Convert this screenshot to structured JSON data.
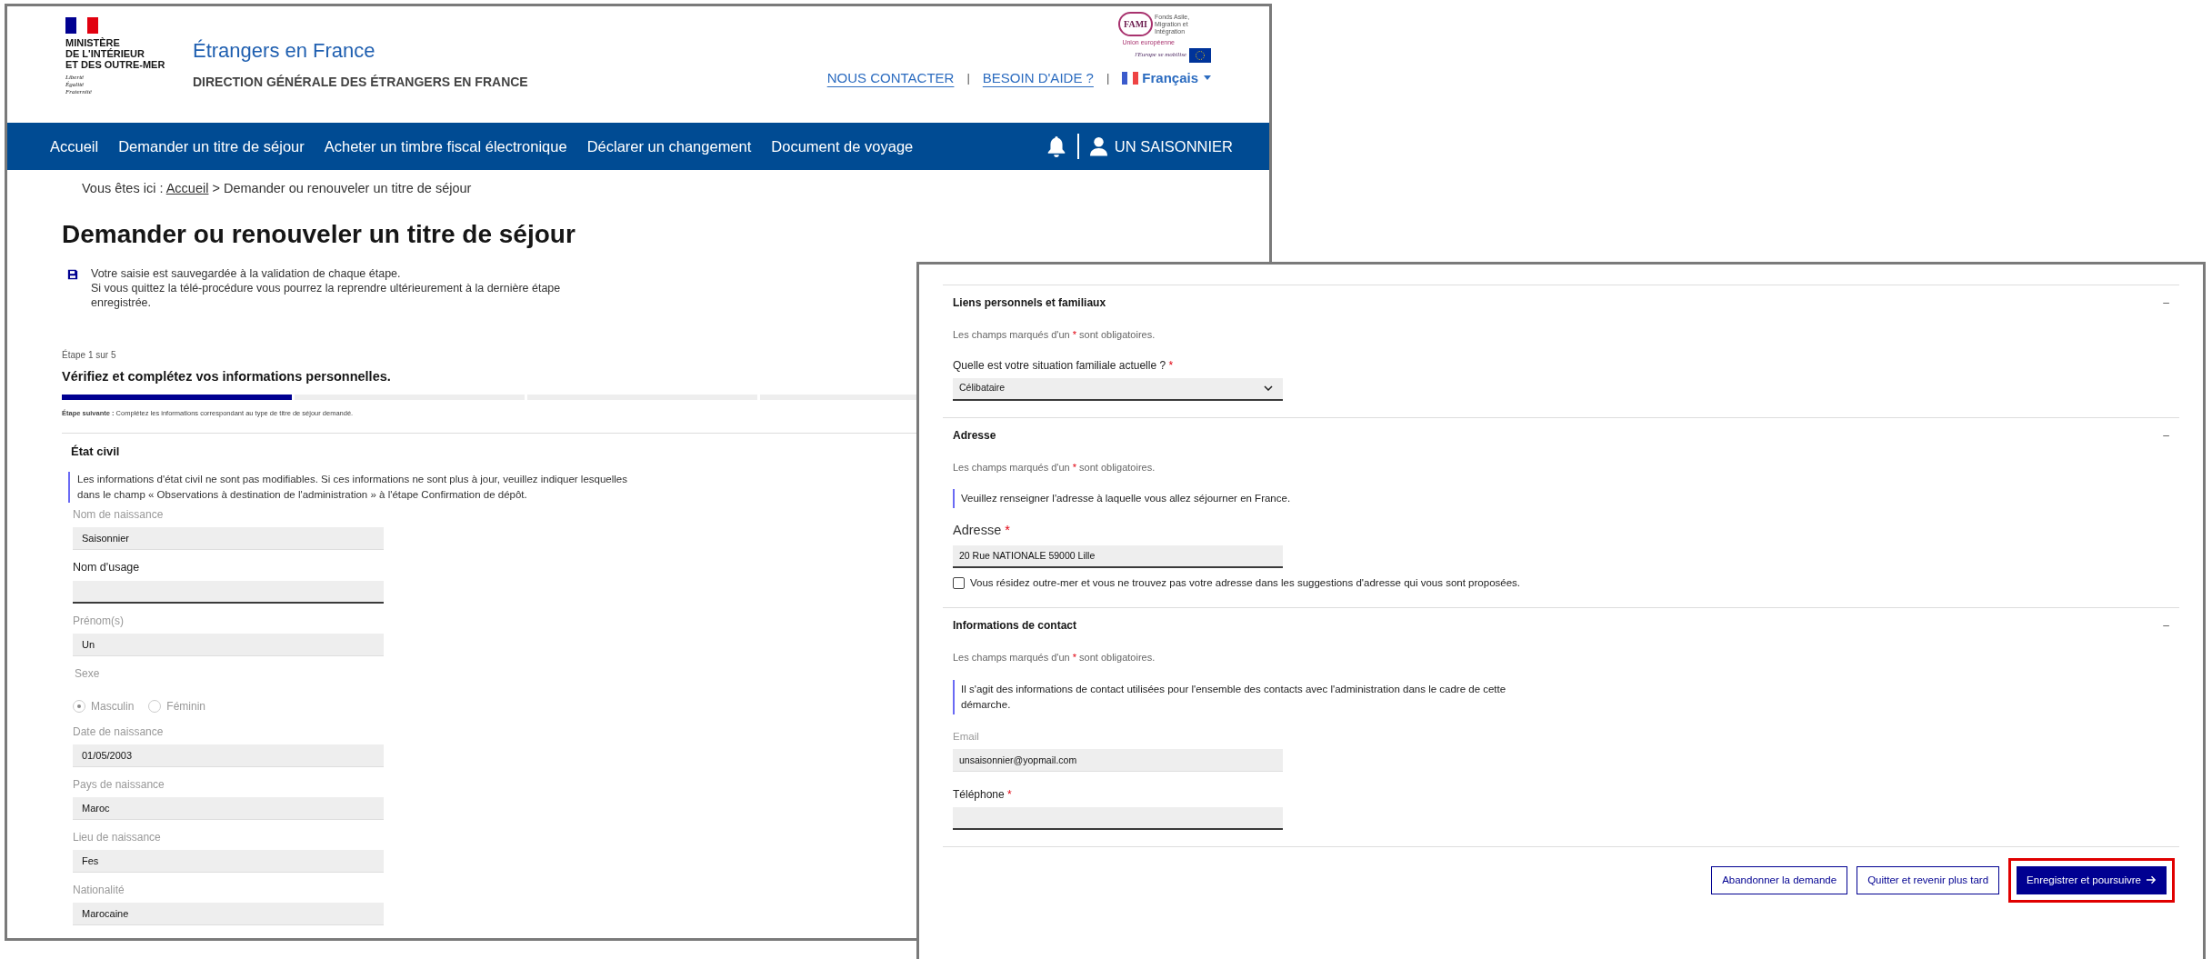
{
  "left_page": {
    "header": {
      "ministry": {
        "lines": [
          "MINISTÈRE",
          "DE L'INTÉRIEUR",
          "ET DES OUTRE-MER"
        ],
        "motto": [
          "Liberté",
          "Égalité",
          "Fraternité"
        ]
      },
      "site_title": "Étrangers en France",
      "site_subtitle": "DIRECTION GÉNÉRALE DES ÉTRANGERS EN FRANCE",
      "partner_logo": {
        "acronym": "FAMI",
        "caption": "Fonds Asile, Migration et Intégration",
        "union": "Union européenne",
        "slogan": "l'Europe se mobilise"
      },
      "links": [
        "NOUS CONTACTER",
        "BESOIN D'AIDE ?"
      ],
      "separator": "|",
      "language": "Français"
    },
    "nav": {
      "items": [
        "Accueil",
        "Demander un titre de séjour",
        "Acheter un timbre fiscal électronique",
        "Déclarer un changement",
        "Document de voyage"
      ],
      "user": "UN SAISONNIER"
    },
    "breadcrumb": {
      "prefix": "Vous êtes ici :",
      "link": "Accueil",
      "current": "> Demander ou renouveler un titre de séjour"
    },
    "title": "Demander ou renouveler un titre de séjour",
    "save_notice": [
      "Votre saisie est sauvegardée à la validation de chaque étape.",
      "Si vous quittez la télé-procédure vous pourrez la reprendre ultérieurement à la dernière étape enregistrée."
    ],
    "step": {
      "counter": "Étape 1 sur 5",
      "title": "Vérifiez et complétez vos informations personnelles.",
      "segments": [
        {
          "filled": true
        },
        {
          "filled": false
        },
        {
          "filled": false
        },
        {
          "filled": false
        }
      ],
      "next": "**Étape suivante :** Complétez les informations correspondant au type de titre de séjour demandé."
    },
    "section": {
      "title": "État civil",
      "info": "Les informations d'état civil ne sont pas modifiables. Si ces informations ne sont plus à jour, veuillez indiquer lesquelles dans le champ « Observations à destination de l'administration » à l'étape Confirmation de dépôt.",
      "fields": [
        {
          "kind": "text",
          "label": "Nom de naissance",
          "value": "Saisonnier",
          "disabled": true
        },
        {
          "kind": "text",
          "label": "Nom d'usage",
          "disabled": false
        },
        {
          "kind": "text",
          "label": "Prénom(s)",
          "value": "Un",
          "disabled": true
        },
        {
          "kind": "radio",
          "label": "Sexe",
          "disabled": true,
          "options": [
            {
              "label": "Masculin",
              "selected": true
            },
            {
              "label": "Féminin",
              "selected": false
            }
          ]
        },
        {
          "kind": "text",
          "label": "Date de naissance",
          "value": "01/05/2003",
          "disabled": true
        },
        {
          "kind": "text",
          "label": "Pays de naissance",
          "value": "Maroc",
          "disabled": true
        },
        {
          "kind": "text",
          "label": "Lieu de naissance",
          "value": "Fes",
          "disabled": true
        },
        {
          "kind": "text",
          "label": "Nationalité",
          "value": "Marocaine",
          "disabled": true
        }
      ]
    }
  },
  "right_page": {
    "sections": [
      {
        "title": "Liens personnels et familiaux",
        "toggle": "–",
        "required_note": {
          "before": "Les champs marqués d'un",
          "star": "*",
          "after": "sont obligatoires."
        },
        "fields": [
          {
            "kind": "select",
            "label": "Quelle est votre situation familiale actuelle ?",
            "required_mark": "*",
            "value": "Célibataire",
            "disabled": false
          }
        ]
      },
      {
        "title": "Adresse",
        "toggle": "–",
        "required_note": {
          "before": "Les champs marqués d'un",
          "star": "*",
          "after": "sont obligatoires."
        },
        "info": "Veuillez renseigner l'adresse à laquelle vous allez séjourner en France.",
        "fields": [
          {
            "kind": "address",
            "label": "Adresse",
            "required_mark": "*",
            "value": "20 Rue NATIONALE 59000 Lille",
            "disabled": false
          },
          {
            "kind": "checkbox",
            "label": "Vous résidez outre-mer et vous ne trouvez pas votre adresse dans les suggestions d'adresse qui vous sont proposées.",
            "checked": false
          }
        ]
      },
      {
        "title": "Informations de contact",
        "toggle": "–",
        "required_note": {
          "before": "Les champs marqués d'un",
          "star": "*",
          "after": "sont obligatoires."
        },
        "info": "Il s'agit des informations de contact utilisées pour l'ensemble des contacts avec l'administration dans le cadre de cette démarche.",
        "fields": [
          {
            "kind": "text",
            "label": "Email",
            "value": "unsaisonnier@yopmail.com",
            "disabled": true
          },
          {
            "kind": "text",
            "label": "Téléphone",
            "required_mark": "*",
            "disabled": false
          }
        ]
      }
    ],
    "buttons": [
      {
        "label": "Abandonner la demande",
        "kind": "secondary",
        "highlighted": false
      },
      {
        "label": "Quitter et revenir plus tard",
        "kind": "secondary",
        "highlighted": false
      },
      {
        "label": "Enregistrer et poursuivre",
        "kind": "primary",
        "highlighted": true
      }
    ]
  }
}
